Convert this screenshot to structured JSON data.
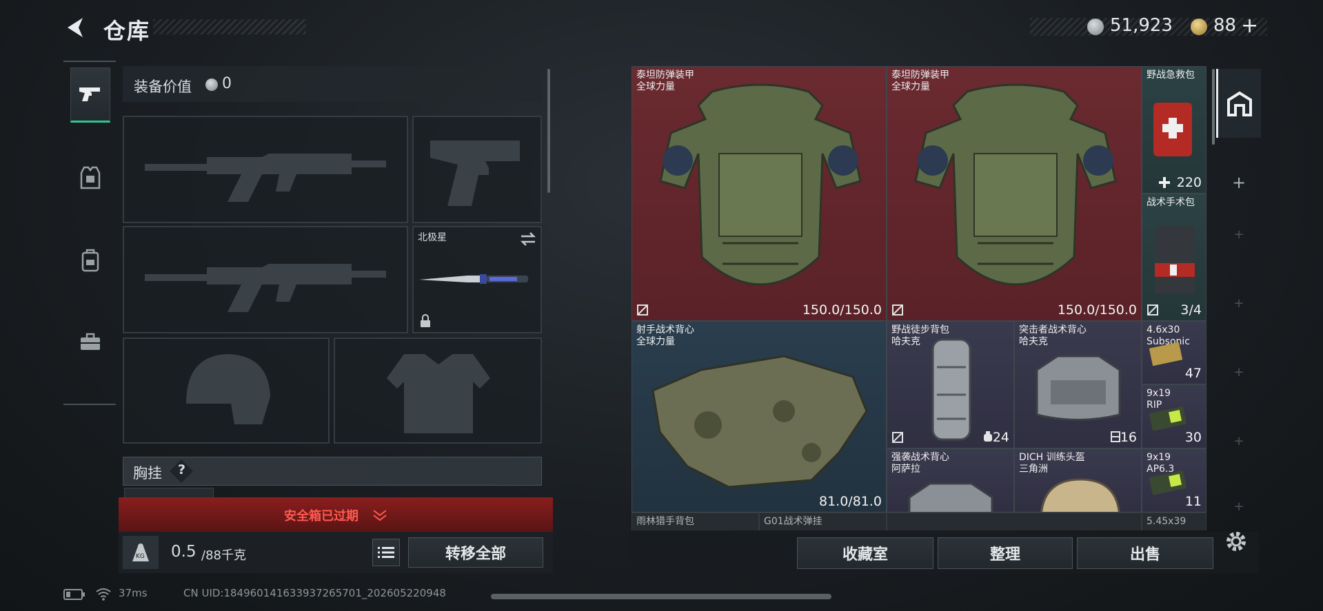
{
  "header": {
    "title": "仓库",
    "currency_silver": "51,923",
    "currency_gold": "88",
    "currency_plus": "+"
  },
  "sidebar": {
    "categories": [
      {
        "name": "weapons",
        "icon": "pistol-icon",
        "active": true
      },
      {
        "name": "armor",
        "icon": "vest-icon",
        "active": false
      },
      {
        "name": "backpack",
        "icon": "backpack-icon",
        "active": false
      },
      {
        "name": "toolbox",
        "icon": "toolbox-icon",
        "active": false
      }
    ]
  },
  "loadout": {
    "equip_value_label": "装备价值",
    "equip_value": "0",
    "melee_name": "北极星",
    "chest_label": "胸挂",
    "chest_help": "?",
    "safe_box_text": "安全箱已过期",
    "weight_current": "0.5",
    "weight_max": "/88千克",
    "transfer_all": "转移全部"
  },
  "inventory": {
    "items": [
      {
        "name": "泰坦防弹装甲",
        "sub": "全球力量",
        "value": "150.0/150.0"
      },
      {
        "name": "泰坦防弹装甲",
        "sub": "全球力量",
        "value": "150.0/150.0"
      },
      {
        "name": "野战急救包",
        "sub": "",
        "value": "220"
      },
      {
        "name": "战术手术包",
        "sub": "",
        "value": "3/4"
      },
      {
        "name": "射手战术背心",
        "sub": "全球力量",
        "value": "81.0/81.0"
      },
      {
        "name": "野战徒步背包",
        "sub": "哈夫克",
        "value": "24"
      },
      {
        "name": "突击者战术背心",
        "sub": "哈夫克",
        "value": "16"
      },
      {
        "name": "4.6x30",
        "sub": "Subsonic",
        "value": "47"
      },
      {
        "name": "9x19",
        "sub": "RIP",
        "value": "30"
      },
      {
        "name": "强袭战术背心",
        "sub": "阿萨拉",
        "value": ""
      },
      {
        "name": "DICH 训练头盔",
        "sub": "三角洲",
        "value": ""
      },
      {
        "name": "9x19",
        "sub": "AP6.3",
        "value": "11"
      },
      {
        "name": "雨林猎手背包",
        "sub": "",
        "value": ""
      },
      {
        "name": "G01战术弹挂",
        "sub": "",
        "value": ""
      },
      {
        "name": "5.45x39",
        "sub": "",
        "value": ""
      }
    ]
  },
  "bottom": {
    "collection": "收藏室",
    "organize": "整理",
    "sell": "出售"
  },
  "footer": {
    "ping": "37ms",
    "uid": "CN UID:184960141633937265701_202605220948"
  },
  "colors": {
    "accent_green": "#2fc58d",
    "rarity_red": "#6a2a30",
    "rarity_blue": "#2a3e4e",
    "rarity_purple": "#3a3a4e",
    "safe_red": "#8a1e1e"
  }
}
